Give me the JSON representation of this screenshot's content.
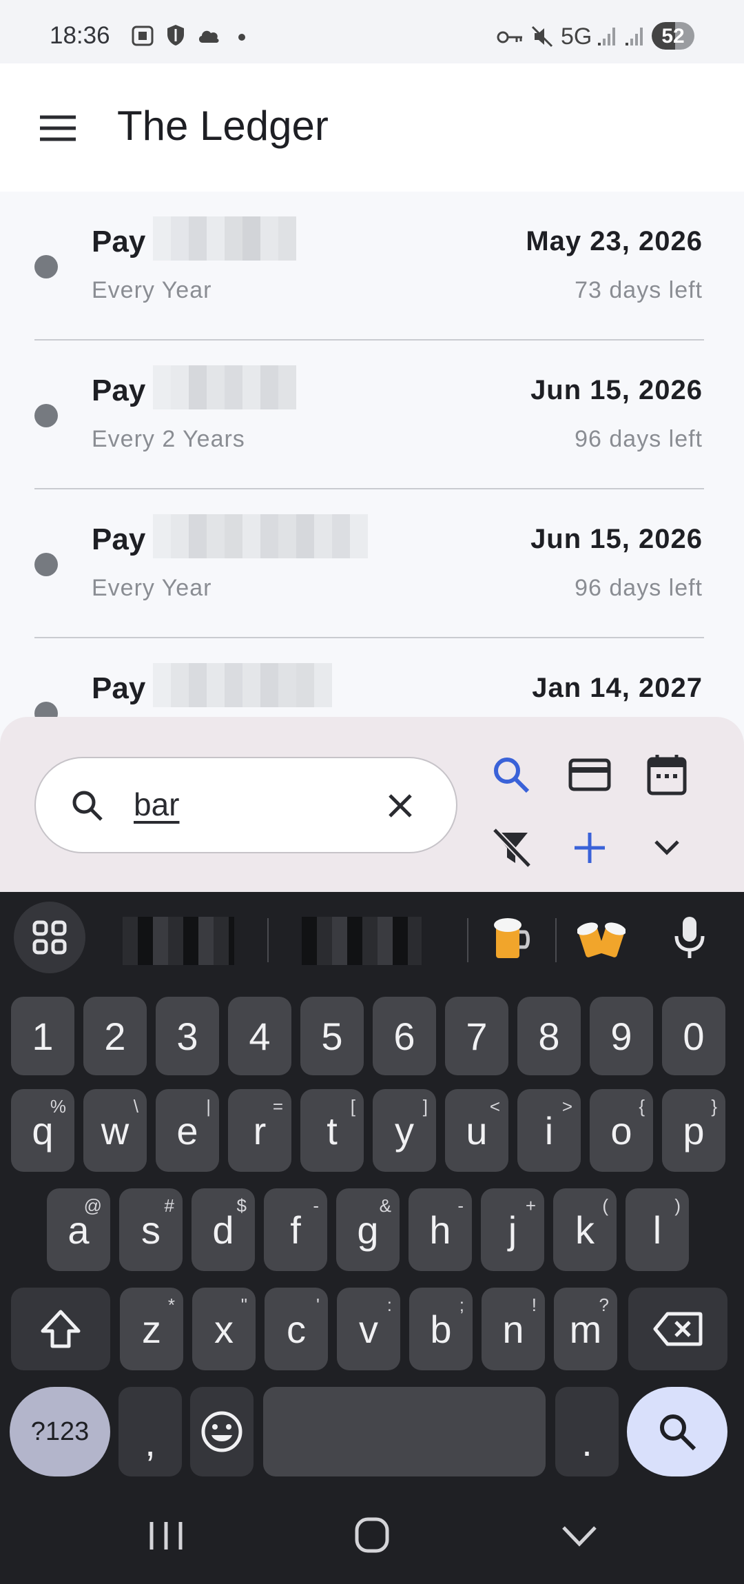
{
  "status_bar": {
    "time": "18:36",
    "battery": "52",
    "network": "5G",
    "icons": [
      "screenshot-icon",
      "shield-icon",
      "cloud-icon",
      "dot-icon",
      "key-icon",
      "mute-icon",
      "signal-icon",
      "signal-icon",
      "battery-icon"
    ]
  },
  "app": {
    "title": "The Ledger",
    "menu_icon": "menu-icon"
  },
  "items": [
    {
      "name": "Pay",
      "frequency": "Every Year",
      "date": "May 23, 2026",
      "days_left": "73 days left"
    },
    {
      "name": "Pay",
      "frequency": "Every 2 Years",
      "date": "Jun 15, 2026",
      "days_left": "96 days left"
    },
    {
      "name": "Pay",
      "frequency": "Every Year",
      "date": "Jun 15, 2026",
      "days_left": "96 days left"
    },
    {
      "name": "Pay",
      "frequency": "",
      "date": "Jan 14, 2027",
      "days_left": ""
    }
  ],
  "search": {
    "value": "bar",
    "search_icon": "search-icon",
    "clear_icon": "close-icon"
  },
  "toolbar": {
    "icons": [
      "search-icon",
      "credit-card-icon",
      "calendar-icon",
      "filter-off-icon",
      "add-icon",
      "chevron-down-icon"
    ],
    "accent": "#3a62d8"
  },
  "keyboard": {
    "number_row": [
      "1",
      "2",
      "3",
      "4",
      "5",
      "6",
      "7",
      "8",
      "9",
      "0"
    ],
    "row1": [
      [
        "q",
        "%"
      ],
      [
        "w",
        "\\"
      ],
      [
        "e",
        "|"
      ],
      [
        "r",
        "="
      ],
      [
        "t",
        "["
      ],
      [
        "y",
        "]"
      ],
      [
        "u",
        "<"
      ],
      [
        "i",
        ">"
      ],
      [
        "o",
        "{"
      ],
      [
        "p",
        "}"
      ]
    ],
    "row2": [
      [
        "a",
        "@"
      ],
      [
        "s",
        "#"
      ],
      [
        "d",
        "$"
      ],
      [
        "f",
        "-"
      ],
      [
        "g",
        "&"
      ],
      [
        "h",
        "-"
      ],
      [
        "j",
        "+"
      ],
      [
        "k",
        "("
      ],
      [
        "l",
        ")"
      ]
    ],
    "row3": [
      [
        "z",
        "*"
      ],
      [
        "x",
        "\""
      ],
      [
        "c",
        "'"
      ],
      [
        "v",
        ":"
      ],
      [
        "b",
        ";"
      ],
      [
        "n",
        "!"
      ],
      [
        "m",
        "?"
      ]
    ],
    "symbols_label": "?123",
    "comma": ",",
    "period": ".",
    "suggestion_icons": [
      "apps-grid-icon",
      "beer-mug-icon",
      "clinking-beers-icon",
      "microphone-icon"
    ]
  },
  "nav_bar": {
    "icons": [
      "recents-icon",
      "home-icon",
      "back-icon"
    ]
  }
}
